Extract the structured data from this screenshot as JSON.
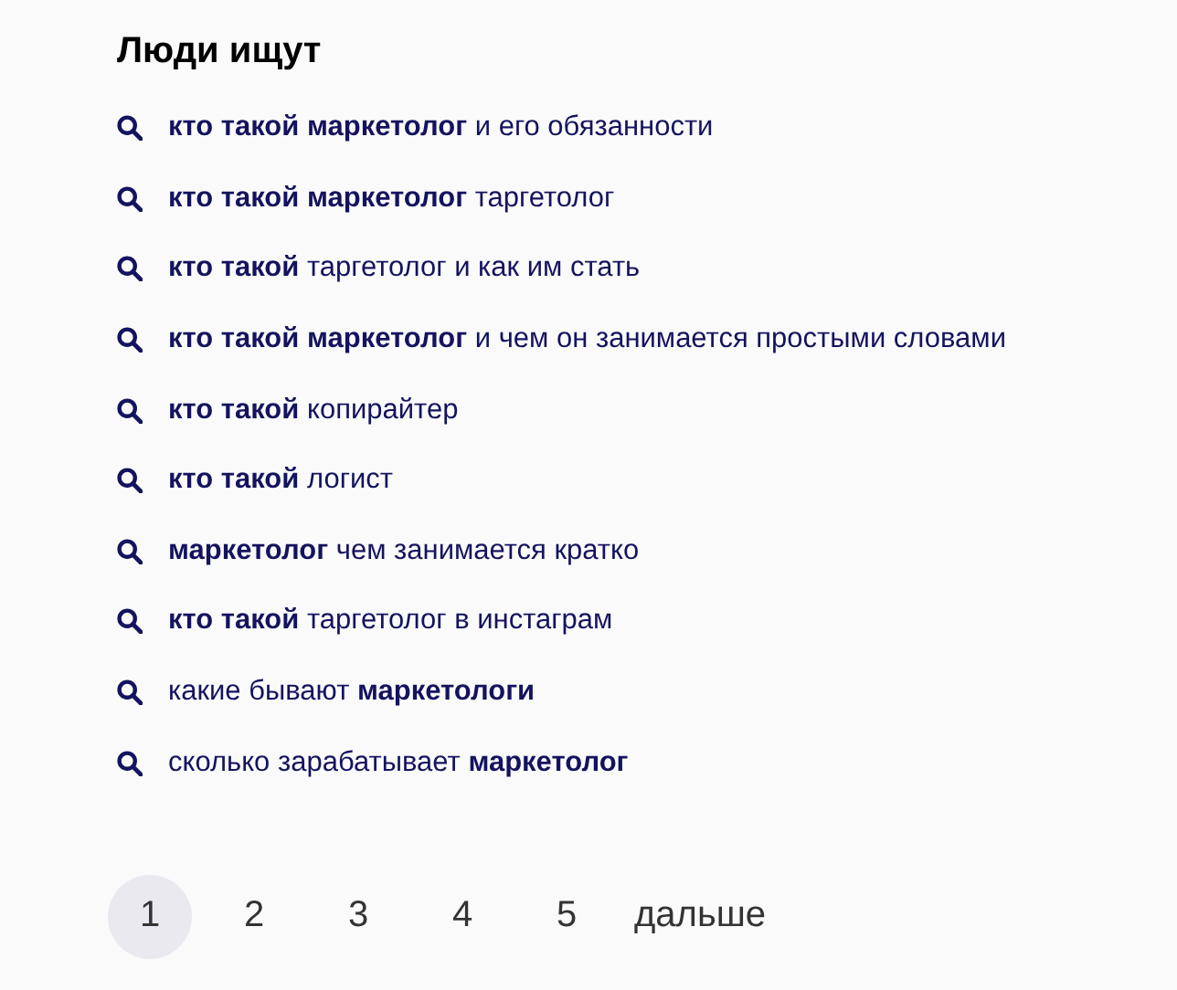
{
  "title": "Люди ищут",
  "queries": [
    {
      "text": "**кто такой маркетолог** и его обязанности"
    },
    {
      "text": "**кто такой маркетолог** таргетолог"
    },
    {
      "text": "**кто такой** таргетолог и как им стать"
    },
    {
      "text": "**кто такой маркетолог** и чем он занимается простыми словами"
    },
    {
      "text": "**кто такой** копирайтер"
    },
    {
      "text": "**кто такой** логист"
    },
    {
      "text": "**маркетолог** чем занимается кратко"
    },
    {
      "text": "**кто такой** таргетолог в инстаграм"
    },
    {
      "text": "какие бывают **маркетологи**"
    },
    {
      "text": "сколько зарабатывает **маркетолог**"
    }
  ],
  "pagination": {
    "pages": [
      {
        "label": "1",
        "selected": true
      },
      {
        "label": "2",
        "selected": false
      },
      {
        "label": "3",
        "selected": false
      },
      {
        "label": "4",
        "selected": false
      },
      {
        "label": "5",
        "selected": false
      }
    ],
    "next": "дальше"
  }
}
